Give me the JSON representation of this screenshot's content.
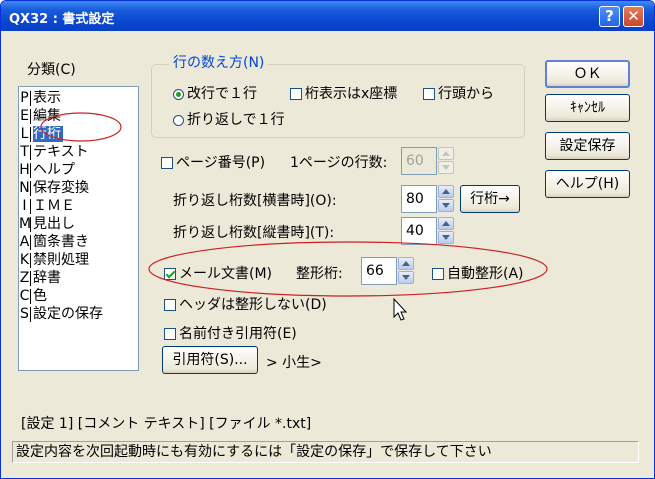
{
  "window": {
    "title": "QX32 : 書式設定",
    "help_glyph": "?",
    "close_glyph": "✕"
  },
  "categories": {
    "label": "分類(C)",
    "items": [
      {
        "key": "P",
        "label": "表示"
      },
      {
        "key": "E",
        "label": "編集"
      },
      {
        "key": "L",
        "label": "行桁",
        "selected": true
      },
      {
        "key": "T",
        "label": "テキスト"
      },
      {
        "key": "H",
        "label": "ヘルプ"
      },
      {
        "key": "N",
        "label": "保存変換"
      },
      {
        "key": "I",
        "label": "ＩＭＥ"
      },
      {
        "key": "M",
        "label": "見出し"
      },
      {
        "key": "A",
        "label": "箇条書き"
      },
      {
        "key": "K",
        "label": "禁則処理"
      },
      {
        "key": "Z",
        "label": "辞書"
      },
      {
        "key": "C",
        "label": "色"
      },
      {
        "key": "S",
        "label": "設定の保存"
      }
    ]
  },
  "line_count": {
    "title": "行の数え方(N)",
    "options": {
      "newline": {
        "label": "改行で１行",
        "checked": true
      },
      "wrap": {
        "label": "折り返しで１行",
        "checked": false
      },
      "x_coord": {
        "label": "桁表示はx座標",
        "checked": false
      },
      "from_line_head": {
        "label": "行頭から",
        "checked": false
      }
    }
  },
  "page_number": {
    "label": "ページ番号(P)",
    "checked": false,
    "lines_label": "1ページの行数:",
    "lines_value": "60"
  },
  "wrap_horizontal": {
    "label": "折り返し桁数[横書時](O):",
    "value": "80",
    "button": "行桁→"
  },
  "wrap_vertical": {
    "label": "折り返し桁数[縦書時](T):",
    "value": "40"
  },
  "mail": {
    "label": "メール文書(M)",
    "checked": true,
    "cols_label": "整形桁:",
    "cols_value": "66",
    "auto_label": "自動整形(A)",
    "auto_checked": false
  },
  "header_noformat": {
    "label": "ヘッダは整形しない(D)",
    "checked": false
  },
  "named_quote": {
    "label": "名前付き引用符(E)",
    "checked": false
  },
  "quote": {
    "button": "引用符(S)...",
    "preview": ">  小生>"
  },
  "buttons": {
    "ok": "ＯＫ",
    "cancel": "ｷｬﾝｾﾙ",
    "save": "設定保存",
    "help": "ヘルプ(H)"
  },
  "info": "[設定 1]  [コメント テキスト]  [ファイル *.txt]",
  "status": "設定内容を次回起動時にも有効にするには「設定の保存」で保存して下さい",
  "colors": {
    "title_bar": "#0a46d0",
    "face": "#ece9d8",
    "selection": "#316ac5",
    "annotation": "#cc2020",
    "group_title": "#0046d5"
  }
}
